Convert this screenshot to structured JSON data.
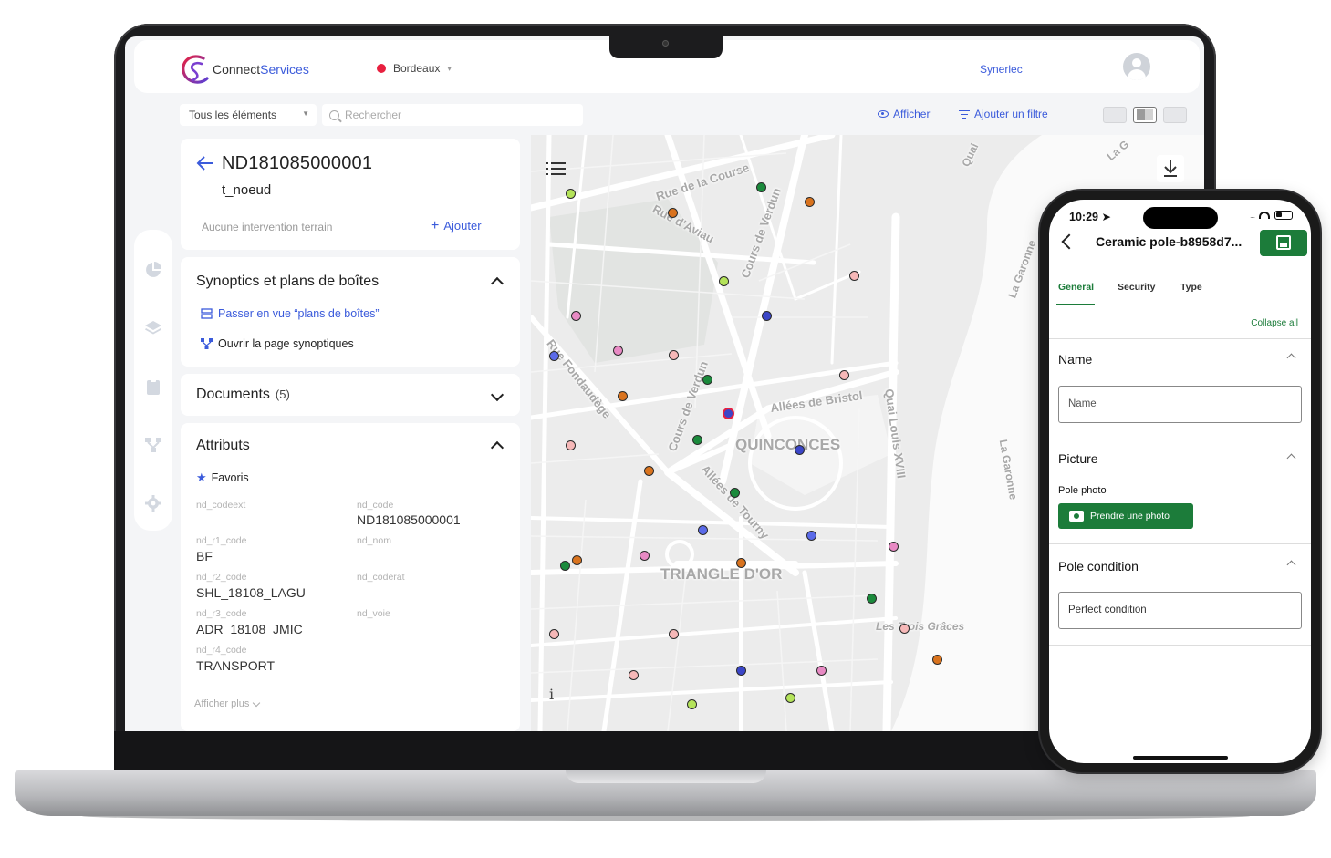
{
  "web": {
    "brand": {
      "part1": "Connect",
      "part2": "Services"
    },
    "city": {
      "name": "Bordeaux",
      "color": "#e8203f"
    },
    "company": "Synerlec",
    "filter": {
      "scope": "Tous les éléments",
      "search_placeholder": "Rechercher",
      "show_label": "Afficher",
      "add_filter_label": "Ajouter un filtre"
    },
    "feature": {
      "id": "ND181085000001",
      "type": "t_noeud",
      "no_intervention": "Aucune intervention terrain",
      "add_label": "Ajouter"
    },
    "synoptics": {
      "title": "Synoptics et plans de boîtes",
      "switch_view": "Passer en vue “plans de boîtes”",
      "open_page": "Ouvrir la page synoptiques"
    },
    "documents": {
      "title": "Documents",
      "count": "(5)"
    },
    "attributes": {
      "title": "Attributs",
      "favorites": "Favoris",
      "left": [
        {
          "key": "nd_codeext",
          "value": ""
        },
        {
          "key": "nd_r1_code",
          "value": "BF"
        },
        {
          "key": "nd_r2_code",
          "value": "SHL_18108_LAGU"
        },
        {
          "key": "nd_r3_code",
          "value": "ADR_18108_JMIC"
        },
        {
          "key": "nd_r4_code",
          "value": "TRANSPORT"
        }
      ],
      "right": [
        {
          "key": "nd_code",
          "value": "ND181085000001"
        },
        {
          "key": "nd_nom",
          "value": ""
        },
        {
          "key": "nd_coderat",
          "value": ""
        },
        {
          "key": "nd_voie",
          "value": ""
        }
      ],
      "show_more": "Afficher plus"
    },
    "map": {
      "labels": [
        "Rue de la Course",
        "Rue d'Aviau",
        "Cours de Verdun",
        "Rue Fondaudège",
        "Cours de Verdun",
        "Allées de Bristol",
        "QUINCONCES",
        "Allées de Tourny",
        "TRIANGLE D'OR",
        "Quai Louis XVIII",
        "La Garonne",
        "La Garonne",
        "Les Trois Grâces",
        "Quai",
        "La G"
      ],
      "info": "i"
    },
    "accent": "#3b5bdb"
  },
  "mobile": {
    "time": "10:29",
    "signal": "....",
    "title": "Ceramic pole-b8958d7...",
    "tabs": [
      "General",
      "Security",
      "Type"
    ],
    "collapse_all": "Collapse all",
    "name_section": {
      "title": "Name",
      "placeholder": "Name"
    },
    "picture_section": {
      "title": "Picture",
      "label": "Pole photo",
      "button": "Prendre une photo"
    },
    "condition_section": {
      "title": "Pole condition",
      "value": "Perfect condition"
    },
    "accent": "#1c7c3a"
  }
}
